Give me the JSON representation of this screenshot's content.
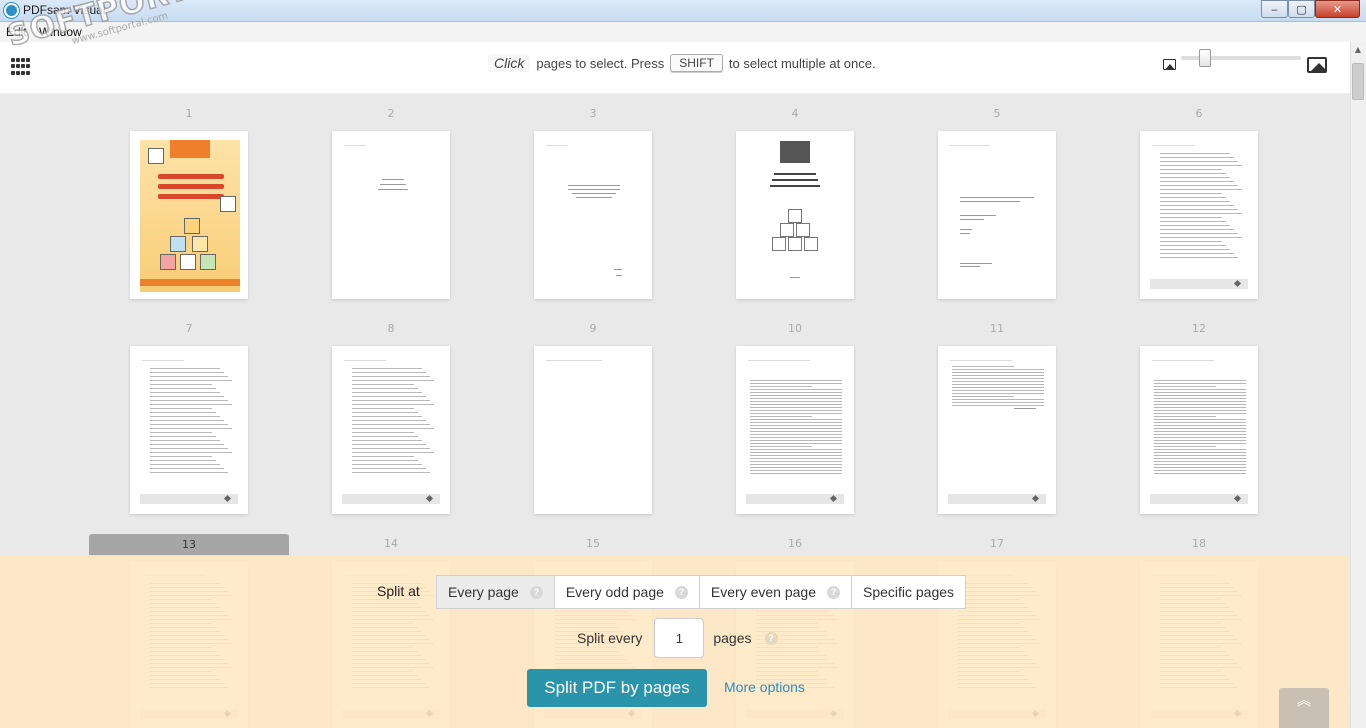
{
  "window": {
    "title": "PDFsam Visual",
    "minimize": "‒",
    "maximize": "▢",
    "close": "✕"
  },
  "menu": {
    "items": [
      "Edit",
      "Window"
    ]
  },
  "toolbar": {
    "hint_click": "Click",
    "hint_mid": "pages to select. Press",
    "hint_key": "SHIFT",
    "hint_end": "to select multiple at once."
  },
  "pages": {
    "numbers": [
      "1",
      "2",
      "3",
      "4",
      "5",
      "6",
      "7",
      "8",
      "9",
      "10",
      "11",
      "12",
      "13",
      "14",
      "15",
      "16",
      "17",
      "18"
    ],
    "selected": "13"
  },
  "split": {
    "label": "Split at",
    "options": [
      "Every page",
      "Every odd page",
      "Every even page",
      "Specific pages"
    ],
    "active_option": "Every page",
    "every_label": "Split every",
    "every_value": "1",
    "every_unit": "pages",
    "help_glyph": "?",
    "run_label": "Split PDF by pages",
    "more_options": "More options",
    "collapse_glyph": "︽"
  },
  "watermark": {
    "main": "SOFTPORTAL",
    "sub": "www.softportal.com"
  },
  "colors": {
    "accent": "#2a94ab",
    "link": "#2a8dc4",
    "panel": "#ffe8bf",
    "selected_tab": "#a6a6a6"
  }
}
